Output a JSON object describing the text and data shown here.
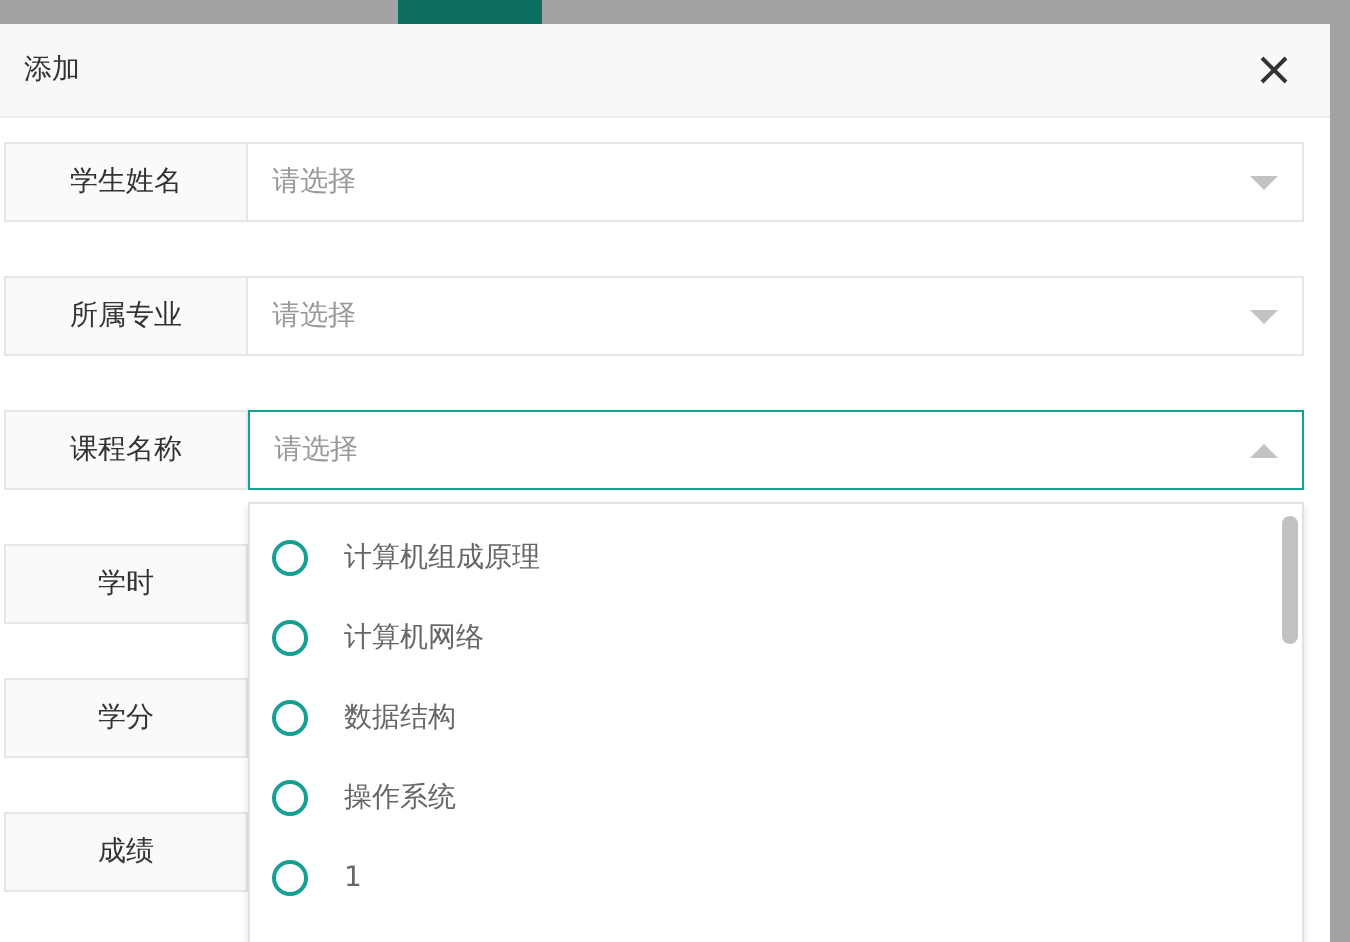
{
  "dialog": {
    "title": "添加",
    "fields": [
      {
        "label": "学生姓名",
        "kind": "select",
        "placeholder": "请选择",
        "open": false
      },
      {
        "label": "所属专业",
        "kind": "select",
        "placeholder": "请选择",
        "open": false
      },
      {
        "label": "课程名称",
        "kind": "select",
        "placeholder": "请选择",
        "open": true,
        "options": [
          {
            "label": "计算机组成原理",
            "selected": false
          },
          {
            "label": "计算机网络",
            "selected": false
          },
          {
            "label": "数据结构",
            "selected": false
          },
          {
            "label": "操作系统",
            "selected": false
          },
          {
            "label": "1",
            "selected": false
          }
        ]
      },
      {
        "label": "学时",
        "kind": "input"
      },
      {
        "label": "学分",
        "kind": "input"
      },
      {
        "label": "成绩",
        "kind": "input"
      }
    ]
  }
}
